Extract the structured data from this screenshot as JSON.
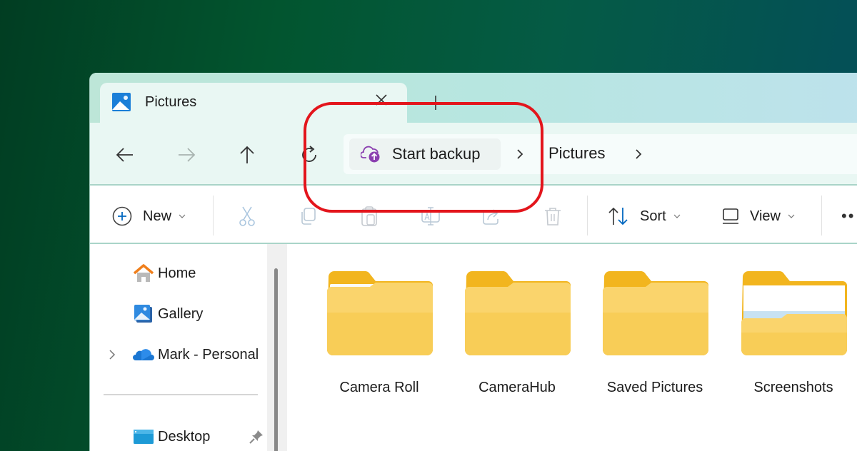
{
  "window": {
    "tab": {
      "title": "Pictures",
      "icon": "pictures-icon",
      "close_icon": "close-icon"
    },
    "new_tab_icon": "plus-icon"
  },
  "navbar": {
    "buttons": [
      {
        "name": "back",
        "icon": "arrow-left-icon",
        "enabled": true
      },
      {
        "name": "forward",
        "icon": "arrow-right-icon",
        "enabled": false
      },
      {
        "name": "up",
        "icon": "arrow-up-icon",
        "enabled": true
      },
      {
        "name": "refresh",
        "icon": "refresh-icon",
        "enabled": true
      }
    ],
    "address": {
      "backup_label": "Start backup",
      "backup_icon": "cloud-upload-icon",
      "crumbs": [
        {
          "label": "Pictures"
        }
      ],
      "separator_icon": "chevron-right-icon"
    }
  },
  "toolbar": {
    "new_label": "New",
    "actions": [
      {
        "name": "cut",
        "icon": "scissors-icon",
        "enabled": false
      },
      {
        "name": "copy",
        "icon": "copy-icon",
        "enabled": false
      },
      {
        "name": "paste",
        "icon": "clipboard-icon",
        "enabled": false
      },
      {
        "name": "rename",
        "icon": "rename-icon",
        "enabled": false
      },
      {
        "name": "share",
        "icon": "share-icon",
        "enabled": false
      },
      {
        "name": "delete",
        "icon": "trash-icon",
        "enabled": false
      }
    ],
    "sort_label": "Sort",
    "view_label": "View",
    "more_label": "••"
  },
  "sidebar": {
    "items": [
      {
        "label": "Home",
        "icon": "home-icon"
      },
      {
        "label": "Gallery",
        "icon": "gallery-icon"
      },
      {
        "label": "Mark - Personal",
        "icon": "onedrive-cloud-icon",
        "expandable": true
      }
    ],
    "pinned": [
      {
        "label": "Desktop",
        "icon": "desktop-icon",
        "pinned": true
      }
    ]
  },
  "content": {
    "folders": [
      {
        "label": "Camera Roll",
        "variant": "paper"
      },
      {
        "label": "CameraHub",
        "variant": "plain"
      },
      {
        "label": "Saved Pictures",
        "variant": "plain"
      },
      {
        "label": "Screenshots",
        "variant": "screenshot"
      }
    ]
  },
  "annotation": {
    "color": "#e3151c",
    "target": "Start backup"
  },
  "colors": {
    "accent": "#0067c0",
    "backup_purple": "#8b3fb0",
    "folder_yellow": "#f8cd57",
    "folder_tab": "#f2b51e"
  }
}
